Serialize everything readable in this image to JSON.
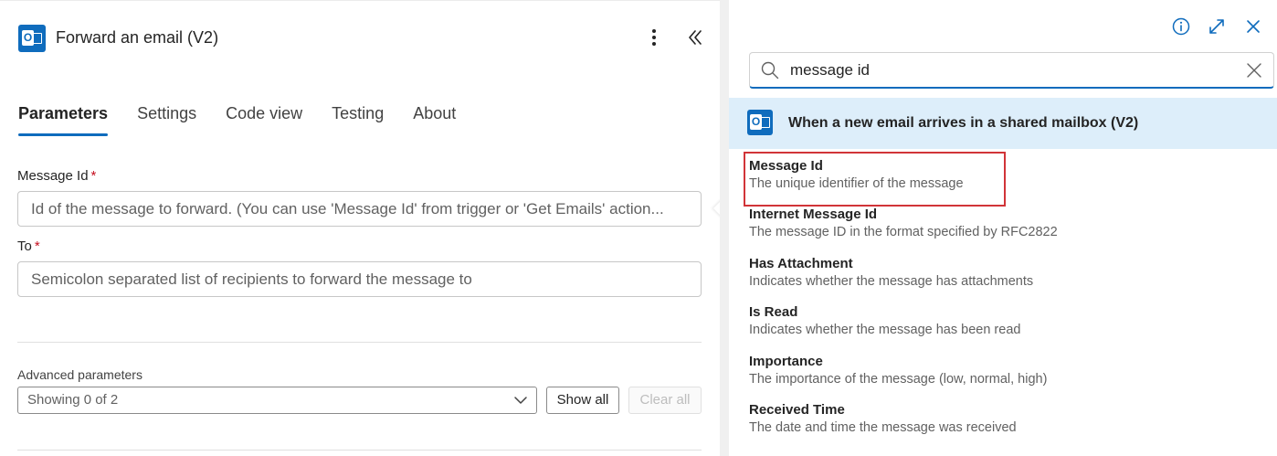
{
  "left_panel": {
    "title": "Forward an email (V2)",
    "tabs": [
      {
        "label": "Parameters",
        "active": true
      },
      {
        "label": "Settings",
        "active": false
      },
      {
        "label": "Code view",
        "active": false
      },
      {
        "label": "Testing",
        "active": false
      },
      {
        "label": "About",
        "active": false
      }
    ],
    "fields": {
      "message_id": {
        "label": "Message Id",
        "required_mark": "*",
        "placeholder": "Id of the message to forward. (You can use 'Message Id' from trigger or 'Get Emails' action..."
      },
      "to": {
        "label": "To",
        "required_mark": "*",
        "placeholder": "Semicolon separated list of recipients to forward the message to"
      }
    },
    "advanced": {
      "label": "Advanced parameters",
      "select_value": "Showing 0 of 2",
      "show_all": "Show all",
      "clear_all": "Clear all"
    }
  },
  "right_panel": {
    "search": {
      "value": "message id"
    },
    "trigger": {
      "title": "When a new email arrives in a shared mailbox (V2)"
    },
    "tokens": [
      {
        "name": "Message Id",
        "desc": "The unique identifier of the message",
        "highlighted": true
      },
      {
        "name": "Internet Message Id",
        "desc": "The message ID in the format specified by RFC2822"
      },
      {
        "name": "Has Attachment",
        "desc": "Indicates whether the message has attachments"
      },
      {
        "name": "Is Read",
        "desc": "Indicates whether the message has been read"
      },
      {
        "name": "Importance",
        "desc": "The importance of the message (low, normal, high)"
      },
      {
        "name": "Received Time",
        "desc": "The date and time the message was received"
      }
    ]
  },
  "colors": {
    "accent": "#0f6cbd",
    "highlight": "#d13438",
    "trigger_bg": "#ddeefa",
    "required": "#c50f1f"
  }
}
